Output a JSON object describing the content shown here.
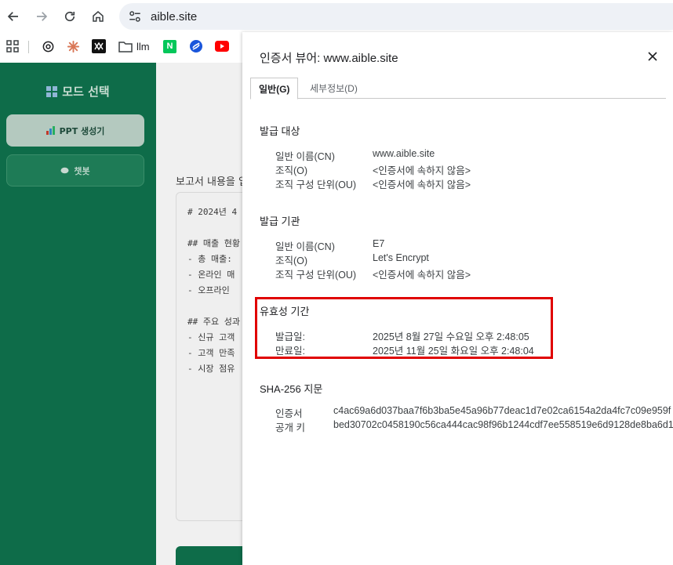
{
  "browser": {
    "url": "aible.site",
    "nav": {
      "back_icon": "arrow-left-icon",
      "forward_icon": "arrow-right-icon",
      "reload_icon": "reload-icon",
      "home_icon": "home-icon"
    },
    "bookmarks": [
      {
        "icon": "apps-grid-icon",
        "label": ""
      },
      {
        "icon": "openai-icon",
        "label": ""
      },
      {
        "icon": "claude-icon",
        "label": ""
      },
      {
        "icon": "app-icon",
        "label": ""
      },
      {
        "icon": "folder-icon",
        "label": "llm"
      },
      {
        "icon": "naver-icon",
        "label": "N"
      },
      {
        "icon": "blue-logo-icon",
        "label": ""
      },
      {
        "icon": "youtube-icon",
        "label": ""
      }
    ]
  },
  "sidebar": {
    "title": "모드 선택",
    "items": [
      {
        "label": "PPT 생성기",
        "active": true
      },
      {
        "label": "챗봇",
        "active": false
      }
    ]
  },
  "main": {
    "label": "보고서 내용을 입",
    "editor_lines": [
      "# 2024년 4",
      "",
      "## 매출 현황",
      "- 총 매출:",
      "- 온라인 매",
      "- 오프라인",
      "",
      "## 주요 성과",
      "- 신규 고객",
      "- 고객 만족",
      "- 시장 점유"
    ]
  },
  "dialog": {
    "title": "인증서 뷰어: www.aible.site",
    "tabs": [
      {
        "label": "일반(G)",
        "active": true
      },
      {
        "label": "세부정보(D)",
        "active": false
      }
    ],
    "subject": {
      "heading": "발급 대상",
      "rows": [
        {
          "label": "일반 이름(CN)",
          "value": "www.aible.site"
        },
        {
          "label": "조직(O)",
          "value": "<인증서에 속하지 않음>"
        },
        {
          "label": "조직 구성 단위(OU)",
          "value": "<인증서에 속하지 않음>"
        }
      ]
    },
    "issuer": {
      "heading": "발급 기관",
      "rows": [
        {
          "label": "일반 이름(CN)",
          "value": "E7"
        },
        {
          "label": "조직(O)",
          "value": "Let's Encrypt"
        },
        {
          "label": "조직 구성 단위(OU)",
          "value": "<인증서에 속하지 않음>"
        }
      ]
    },
    "validity": {
      "heading": "유효성 기간",
      "highlight_color": "#e00000",
      "rows": [
        {
          "label": "발급일:",
          "value": "2025년 8월 27일 수요일 오후 2:48:05"
        },
        {
          "label": "만료일:",
          "value": "2025년 11월 25일 화요일 오후 2:48:04"
        }
      ]
    },
    "fingerprints": {
      "heading": "SHA-256 지문",
      "rows": [
        {
          "label": "인증서",
          "value": "c4ac69a6d037baa7f6b3ba5e45a96b77deac1d7e02ca6154a2da4fc7c09e959f"
        },
        {
          "label": "공개 키",
          "value": "bed30702c0458190c56ca444cac98f96b1244cdf7ee558519e6d9128de8ba6d1"
        }
      ]
    }
  },
  "colors": {
    "sidebar_bg": "#0e6c49",
    "highlight": "#e00000"
  }
}
